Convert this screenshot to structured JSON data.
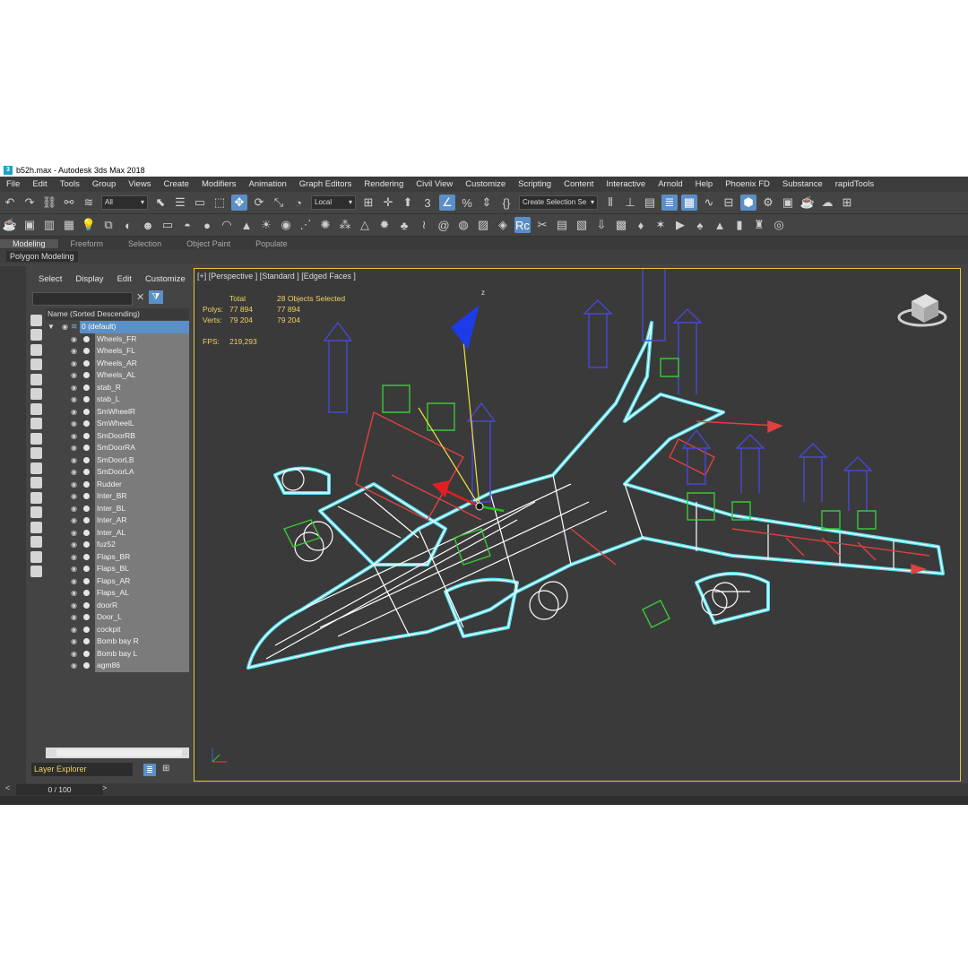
{
  "title": "b52h.max - Autodesk 3ds Max 2018",
  "app_icon": "3",
  "menu": [
    "File",
    "Edit",
    "Tools",
    "Group",
    "Views",
    "Create",
    "Modifiers",
    "Animation",
    "Graph Editors",
    "Rendering",
    "Civil View",
    "Customize",
    "Scripting",
    "Content",
    "Interactive",
    "Arnold",
    "Help",
    "Phoenix FD",
    "Substance",
    "rapidTools"
  ],
  "toolbar": {
    "selection_filter": "All",
    "coord_system": "Local",
    "named_selection_placeholder": "Create Selection Se"
  },
  "ribbon": {
    "tabs": [
      "Modeling",
      "Freeform",
      "Selection",
      "Object Paint",
      "Populate"
    ],
    "active_tab": "Modeling",
    "panel_button": "Polygon Modeling"
  },
  "explorer": {
    "menu": [
      "Select",
      "Display",
      "Edit",
      "Customize"
    ],
    "column_header": "Name (Sorted Descending)",
    "root_layer": "0 (default)",
    "objects": [
      "Wheels_FR",
      "Wheels_FL",
      "Wheels_AR",
      "Wheels_AL",
      "stab_R",
      "stab_L",
      "SmWheelR",
      "SmWheelL",
      "SmDoorRB",
      "SmDoorRA",
      "SmDoorLB",
      "SmDoorLA",
      "Rudder",
      "Inter_BR",
      "Inter_BL",
      "Inter_AR",
      "Inter_AL",
      "fuz52",
      "Flaps_BR",
      "Flaps_BL",
      "Flaps_AR",
      "Flaps_AL",
      "doorR",
      "Door_L",
      "cockpit",
      "Bomb bay R",
      "Bomb bay L",
      "agm86"
    ],
    "footer_dropdown": "Layer Explorer"
  },
  "viewport": {
    "label": "[+] [Perspective ] [Standard ] [Edged Faces ]",
    "stats": {
      "total_label": "Total",
      "selected_label": "28 Objects Selected",
      "polys_label": "Polys:",
      "polys_total": "77 894",
      "polys_selected": "77 894",
      "verts_label": "Verts:",
      "verts_total": "79 204",
      "verts_selected": "79 204",
      "fps_label": "FPS:",
      "fps_value": "219,293"
    },
    "gizmo_axis_label": "z",
    "highlight_color": "#e2c63c",
    "wire_color": "#ffffff",
    "selection_outline_color": "#55e0f0"
  },
  "timeline": {
    "frame": "0 / 100",
    "prev": "<",
    "next": ">"
  }
}
